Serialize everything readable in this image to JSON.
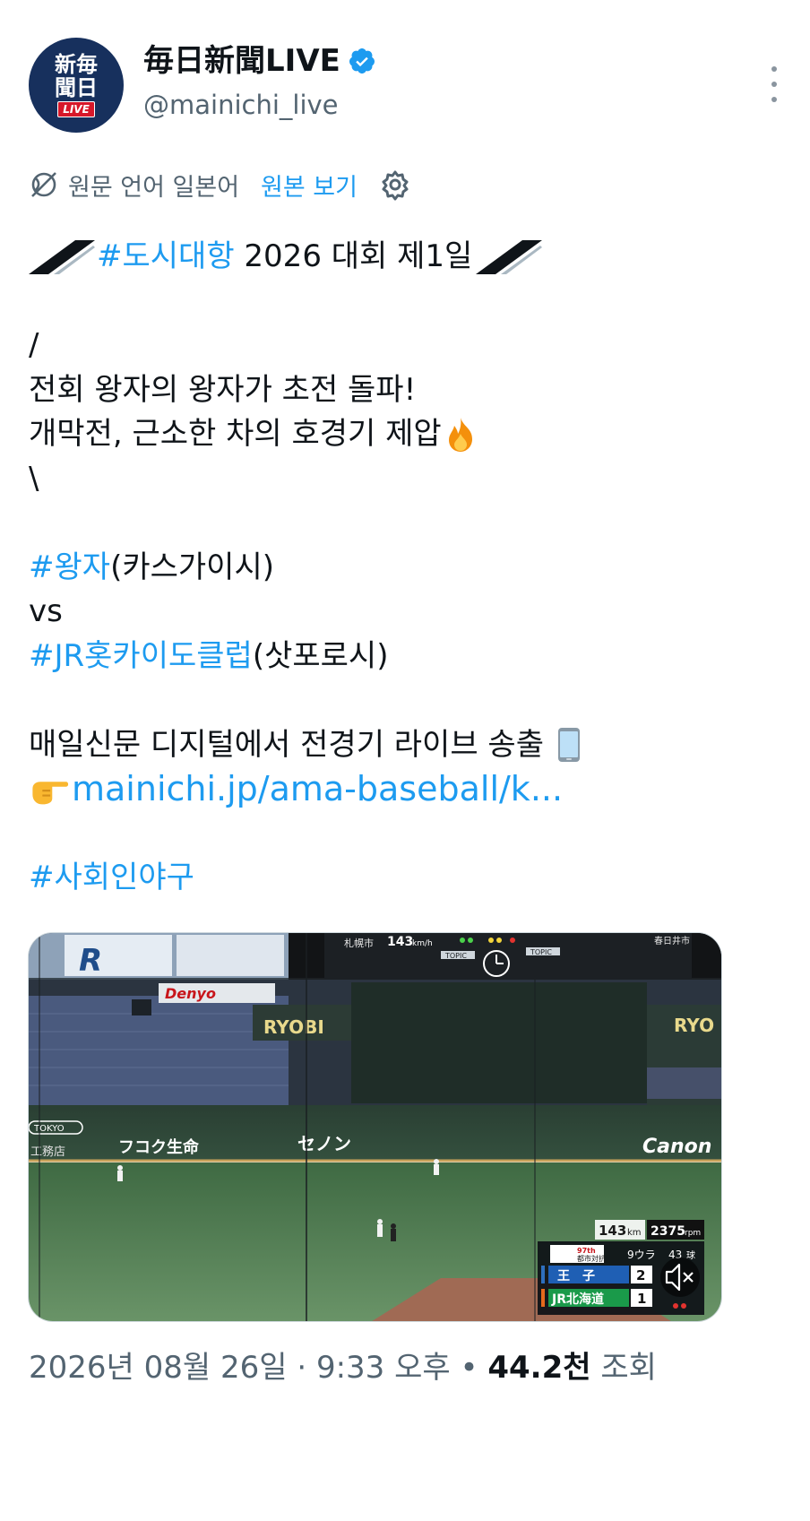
{
  "author": {
    "avatar_text": "新毎聞日",
    "avatar_badge": "LIVE",
    "display_name": "毎日新聞LIVE",
    "handle": "@mainichi_live",
    "verified_color": "#1d9bf0"
  },
  "translation": {
    "original_language": "원문 언어 일본어",
    "show_original": "원본 보기"
  },
  "tweet": {
    "line1_tag": "#도시대항",
    "line1_text": " 2026 대회 제1일",
    "open_slash": "/",
    "headline1": "전회 왕자의 왕자가 초전 돌파!",
    "headline2": "개막전, 근소한 차의 호경기 제압",
    "close_slash": "\\",
    "team1_tag": "#왕자",
    "team1_city": "(카스가이시)",
    "versus": "vs",
    "team2_tag": "#JR홋카이도클럽",
    "team2_city": "(삿포로시)",
    "stream_note": "매일신문 디지털에서 전경기 라이브 송출",
    "link": "mainichi.jp/ama-baseball/k...",
    "footer_tag": "#사회인야구"
  },
  "scoreboard": {
    "speed": "143",
    "speed_unit": "km",
    "rpm": "2375",
    "rpm_unit": "rpm",
    "edition": "97th",
    "tournament": "都市対抗",
    "inning": "9ウラ",
    "pitch_count": "43",
    "pitch_unit": "球",
    "team1_name": "王　子",
    "team1_score": "2",
    "team2_name": "JR北海道",
    "team2_score": "1",
    "board_speed": "143",
    "board_speed_unit": "km/h",
    "topic": "TOPIC",
    "city1": "札幌市",
    "city2": "春日井市"
  },
  "stadium_signs": {
    "denyo": "Denyo",
    "ryobi": "RYOBI",
    "ryobi2": "RYO",
    "fukoku": "フコク生命",
    "senon": "セノン",
    "canon": "Canon",
    "tokyo": "TOKYO",
    "koumuten": "工務店"
  },
  "meta": {
    "date": "2026년 08월 26일",
    "time": "9:33 오후",
    "views_count": "44.2천",
    "views_label": "조회"
  },
  "colors": {
    "link": "#1d9bf0",
    "secondary_text": "#536471",
    "avatar_bg": "#17305d",
    "live_red": "#d7182a"
  }
}
